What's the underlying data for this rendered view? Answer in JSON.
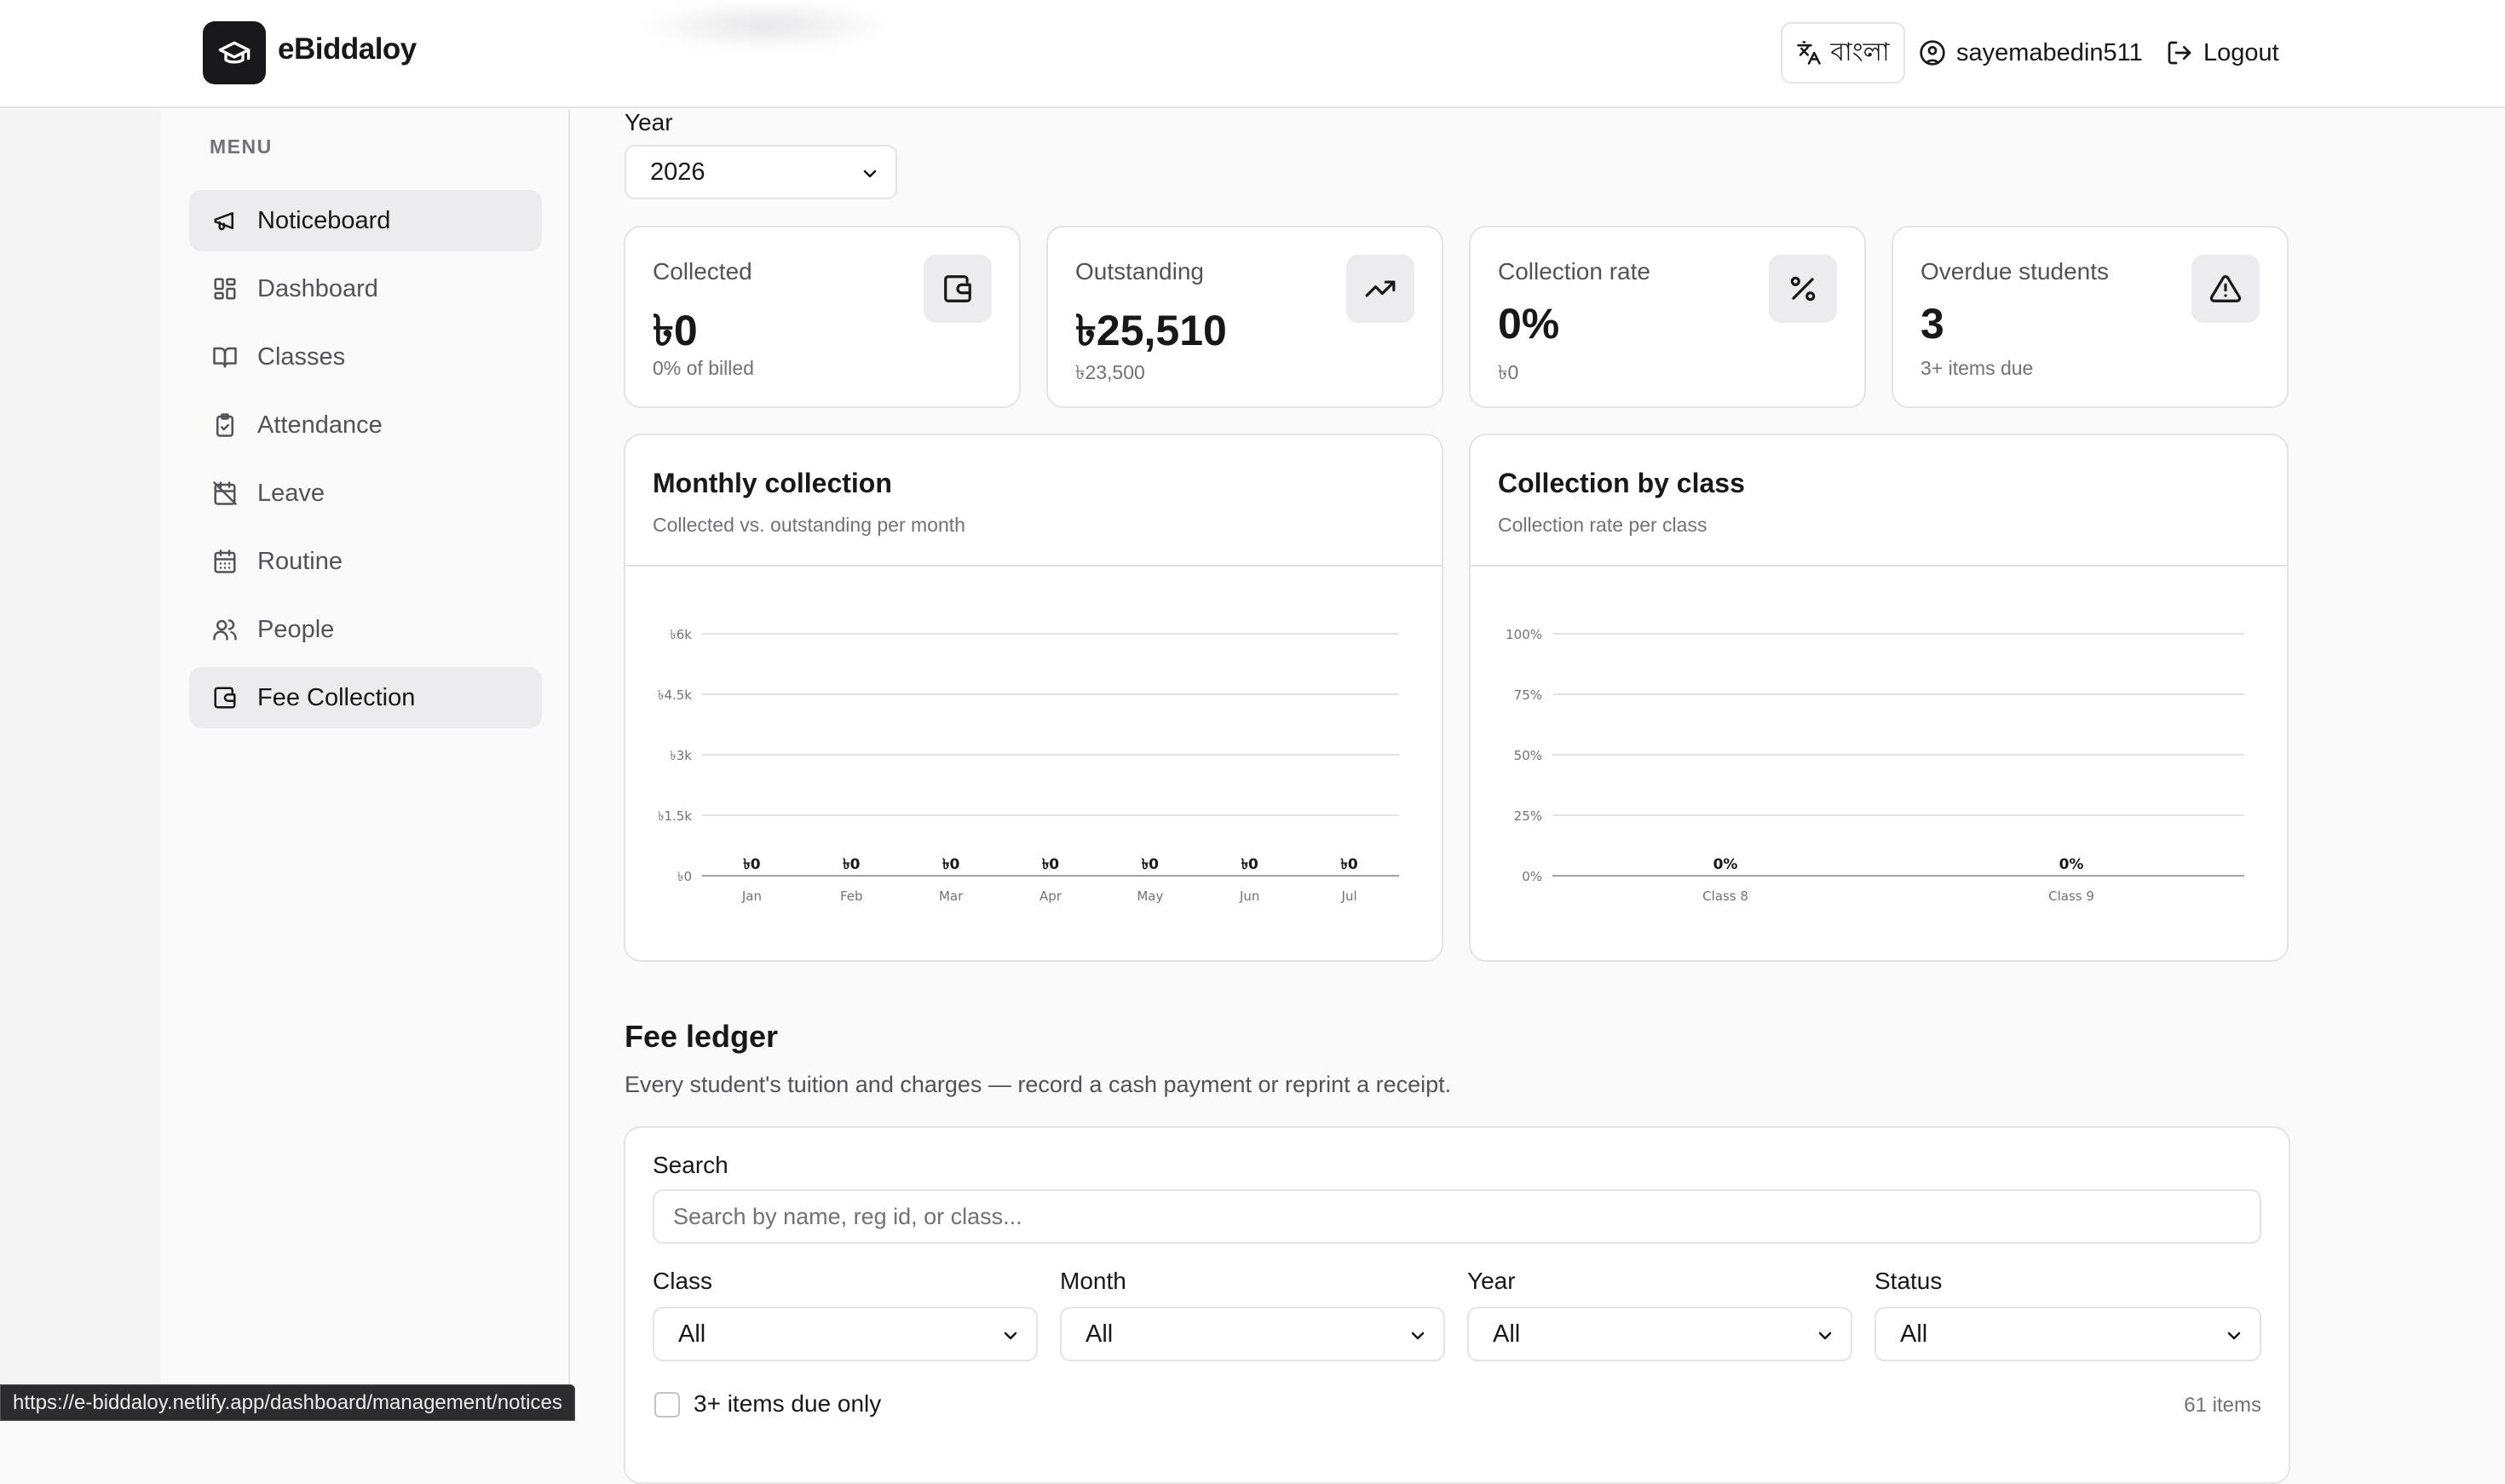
{
  "app": {
    "name": "eBiddaloy"
  },
  "header": {
    "language_label": "বাংলা",
    "username": "sayemabedin511",
    "logout_label": "Logout"
  },
  "sidebar": {
    "menu_label": "MENU",
    "items": [
      {
        "label": "Noticeboard",
        "icon": "megaphone-icon"
      },
      {
        "label": "Dashboard",
        "icon": "dashboard-grid-icon"
      },
      {
        "label": "Classes",
        "icon": "book-open-icon"
      },
      {
        "label": "Attendance",
        "icon": "clipboard-check-icon"
      },
      {
        "label": "Leave",
        "icon": "calendar-off-icon"
      },
      {
        "label": "Routine",
        "icon": "calendar-icon"
      },
      {
        "label": "People",
        "icon": "users-icon"
      },
      {
        "label": "Fee Collection",
        "icon": "wallet-icon"
      }
    ]
  },
  "filters": {
    "year_label": "Year",
    "year_value": "2026"
  },
  "stats": [
    {
      "label": "Collected",
      "value": "৳0",
      "sub": "0% of billed",
      "icon": "wallet-icon"
    },
    {
      "label": "Outstanding",
      "value": "৳25,510",
      "sub": "৳23,500",
      "icon": "trending-up-icon"
    },
    {
      "label": "Collection rate",
      "value": "0%",
      "sub": "৳0",
      "icon": "percent-icon"
    },
    {
      "label": "Overdue students",
      "value": "3",
      "sub": "3+ items due",
      "icon": "warning-triangle-icon"
    }
  ],
  "chart_data": [
    {
      "type": "bar",
      "title": "Monthly collection",
      "subtitle": "Collected vs. outstanding per month",
      "categories": [
        "Jan",
        "Feb",
        "Mar",
        "Apr",
        "May",
        "Jun",
        "Jul"
      ],
      "values": [
        0,
        0,
        0,
        0,
        0,
        0,
        0
      ],
      "data_labels": [
        "৳0",
        "৳0",
        "৳0",
        "৳0",
        "৳0",
        "৳0",
        "৳0"
      ],
      "ylim": [
        0,
        6000
      ],
      "yticks": [
        0,
        1500,
        3000,
        4500,
        6000
      ],
      "ytick_labels": [
        "৳0",
        "৳1.5k",
        "৳3k",
        "৳4.5k",
        "৳6k"
      ],
      "grid": true
    },
    {
      "type": "bar",
      "title": "Collection by class",
      "subtitle": "Collection rate per class",
      "categories": [
        "Class 8",
        "Class 9"
      ],
      "values": [
        0,
        0
      ],
      "data_labels": [
        "0%",
        "0%"
      ],
      "ylim": [
        0,
        100
      ],
      "yticks": [
        0,
        25,
        50,
        75,
        100
      ],
      "ytick_labels": [
        "0%",
        "25%",
        "50%",
        "75%",
        "100%"
      ],
      "grid": true
    }
  ],
  "ledger": {
    "title": "Fee ledger",
    "subtitle": "Every student's tuition and charges — record a cash payment or reprint a receipt.",
    "search_label": "Search",
    "search_placeholder": "Search by name, reg id, or class...",
    "class_label": "Class",
    "class_value": "All",
    "month_label": "Month",
    "month_value": "All",
    "year_label": "Year",
    "year_value": "All",
    "status_label": "Status",
    "status_value": "All",
    "checkbox_label": "3+ items due only",
    "items_count": "61 items"
  },
  "status_url": "https://e-biddaloy.netlify.app/dashboard/management/notices"
}
